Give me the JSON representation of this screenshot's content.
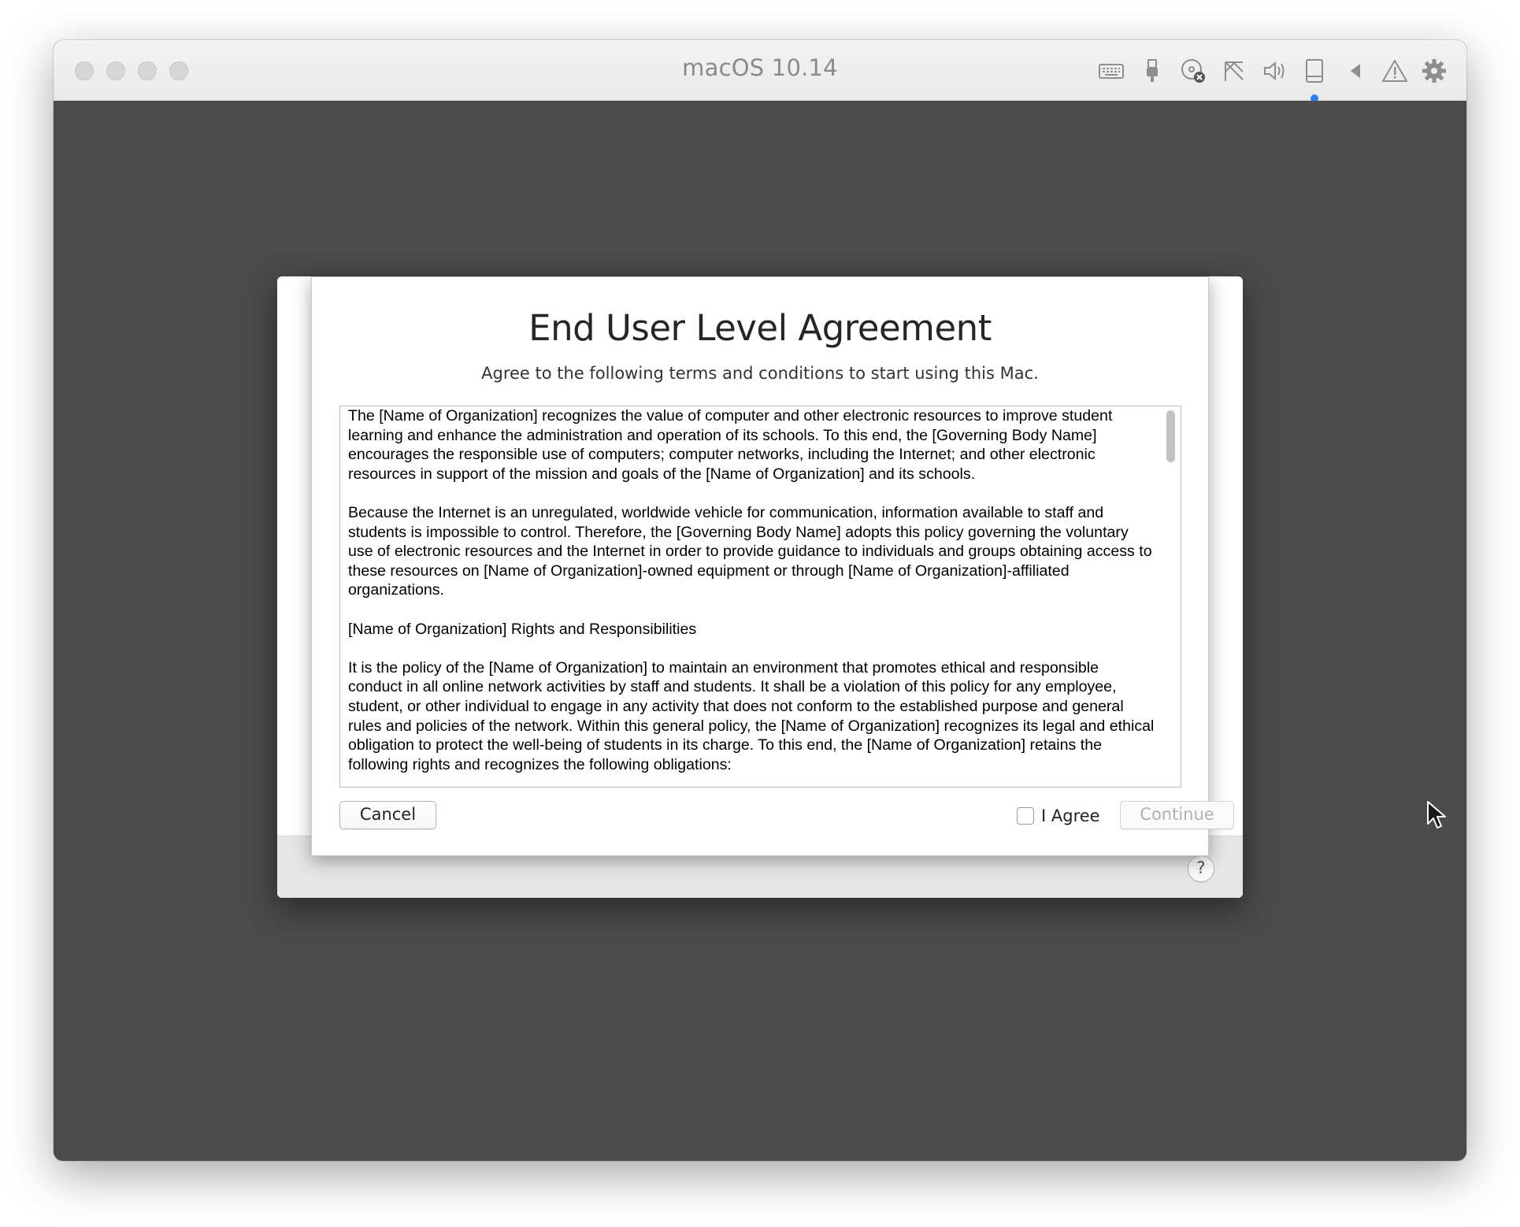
{
  "window": {
    "title": "macOS 10.14"
  },
  "toolbar": {
    "icons": [
      "keyboard-icon",
      "usb-icon",
      "cd-dvd-icon",
      "network-icon",
      "sound-icon",
      "hard-disk-icon",
      "back-arrow-icon",
      "warning-icon",
      "gear-icon"
    ]
  },
  "dialog": {
    "title": "End User Level Agreement",
    "subtitle": "Agree to the following terms and conditions to start using this Mac.",
    "terms": [
      "The [Name of Organization] recognizes the value of computer and other electronic resources to improve student learning and enhance the administration and operation of its schools. To this end, the [Governing Body Name] encourages the responsible use of computers; computer networks, including the Internet; and other electronic resources in support of the mission and goals of the [Name of Organization] and its schools.",
      "Because the Internet is an unregulated, worldwide vehicle for communication, information available to staff and students is impossible to control. Therefore, the [Governing Body Name] adopts this policy governing the voluntary use of electronic resources and the Internet in order to provide guidance to individuals and groups obtaining access to these resources on [Name of Organization]-owned equipment or through [Name of Organization]-affiliated organizations.",
      "[Name of Organization] Rights and Responsibilities",
      "It is the policy of the [Name of Organization] to maintain an environment that promotes ethical and responsible conduct in all online network activities by staff and students. It shall be a violation of this policy for any employee, student, or other individual to engage in any activity that does not conform to the established purpose and general rules and policies of the network. Within this general policy, the [Name of Organization] recognizes its legal and ethical obligation to protect the well-being of students in its charge. To this end, the [Name of Organization] retains the following rights and recognizes the following obligations:"
    ],
    "cancel_label": "Cancel",
    "agree_label": "I Agree",
    "agree_checked": false,
    "continue_label": "Continue",
    "continue_enabled": false,
    "help_label": "?"
  }
}
